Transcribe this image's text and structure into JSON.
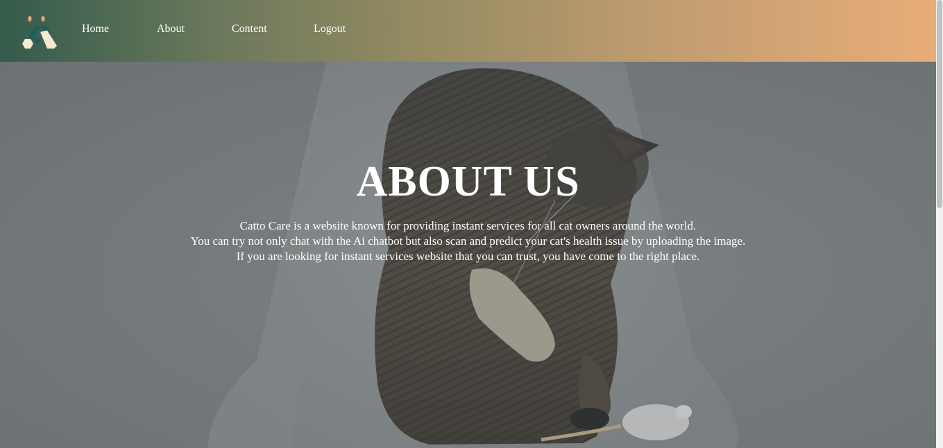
{
  "navbar": {
    "logo_icon": "catto-care-logo-icon",
    "links": [
      "Home",
      "About",
      "Content",
      "Logout"
    ]
  },
  "hero": {
    "image_icon": "tabby-cat-playing-with-toy-mouse",
    "title": "ABOUT US",
    "paragraph": [
      "Catto Care is a website known for providing instant services for all cat owners around the world.",
      "You can try not only chat with the Ai chatbot but also scan and predict your cat's health issue by uploading the image.",
      "If you are looking for instant services website that you can trust, you have come to the right place."
    ]
  },
  "colors": {
    "nav_gradient_start": "#345b4c",
    "nav_gradient_end": "#e8ad79",
    "text": "#ffffff",
    "logo_teal": "#1d5f5c",
    "logo_cream": "#f4ead0",
    "logo_peach": "#e8a877"
  }
}
